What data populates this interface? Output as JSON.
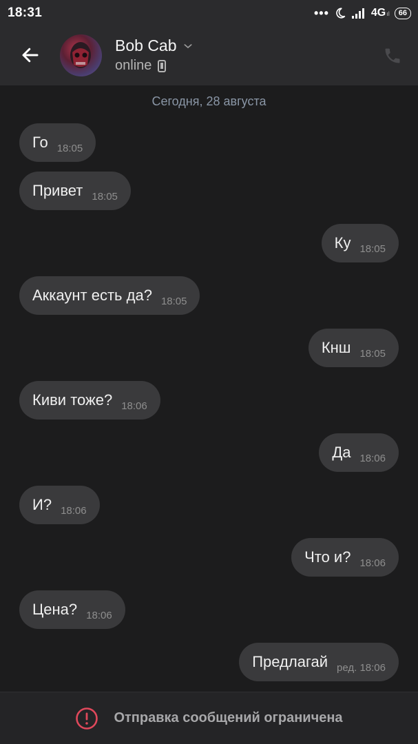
{
  "status_bar": {
    "time": "18:31",
    "dots": "•••",
    "network": "4G",
    "network_sub": "ıl",
    "battery": "66"
  },
  "header": {
    "name": "Bob Cab",
    "status": "online"
  },
  "chat": {
    "date_separator": "Сегодня, 28 августа",
    "messages": [
      {
        "text": "Го",
        "time": "18:05",
        "side": "in"
      },
      {
        "text": "Привет",
        "time": "18:05",
        "side": "in"
      },
      {
        "text": "Ку",
        "time": "18:05",
        "side": "out"
      },
      {
        "text": "Аккаунт есть да?",
        "time": "18:05",
        "side": "in"
      },
      {
        "text": "Кнш",
        "time": "18:05",
        "side": "out"
      },
      {
        "text": "Киви тоже?",
        "time": "18:06",
        "side": "in"
      },
      {
        "text": "Да",
        "time": "18:06",
        "side": "out"
      },
      {
        "text": "И?",
        "time": "18:06",
        "side": "in"
      },
      {
        "text": "Что и?",
        "time": "18:06",
        "side": "out"
      },
      {
        "text": "Цена?",
        "time": "18:06",
        "side": "in"
      },
      {
        "text": "Предлагай",
        "time": "ред. 18:06",
        "side": "out"
      }
    ]
  },
  "bottom": {
    "restriction_text": "Отправка сообщений ограничена"
  },
  "colors": {
    "background": "#1c1c1d",
    "header": "#2b2b2d",
    "bubble": "#3a3a3c",
    "alert": "#e0485b"
  }
}
